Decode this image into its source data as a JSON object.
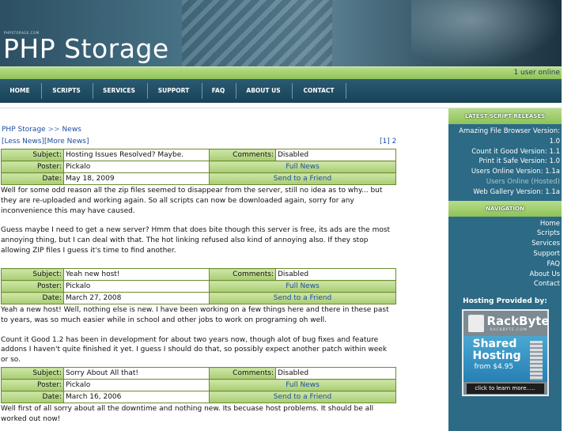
{
  "site": {
    "title": "PHP Storage",
    "header_fineprint": "PHPSTORAGE.COM",
    "users_online": "1 user online"
  },
  "nav": {
    "items": [
      {
        "label": "HOME"
      },
      {
        "label": "SCRIPTS"
      },
      {
        "label": "SERVICES"
      },
      {
        "label": "SUPPORT"
      },
      {
        "label": "FAQ"
      },
      {
        "label": "ABOUT US"
      },
      {
        "label": "CONTACT"
      }
    ]
  },
  "breadcrumb": {
    "root": "PHP Storage",
    "separator": ">>",
    "current": "News"
  },
  "pager": {
    "less": "[Less News]",
    "more": "[More News]",
    "page_current": "[1]",
    "page_next": "2"
  },
  "labels": {
    "subject": "Subject:",
    "poster": "Poster:",
    "date": "Date:",
    "comments": "Comments:",
    "full_news": "Full News",
    "send": "Send to a Friend"
  },
  "news": [
    {
      "subject": "Hosting Issues Resolved? Maybe.",
      "poster": "Pickalo",
      "date": "May 18, 2009",
      "comments": "Disabled",
      "body": [
        "Well for some odd reason all the zip files seemed to disappear from the server, still no idea as to why... but they are re-uploaded and working again. So all scripts can now be downloaded again, sorry for any inconvenience this may have caused.",
        "Guess maybe I need to get a new server? Hmm that does bite though this server is free, its ads are the most annoying thing, but I can deal with that. The hot linking refused also kind of annoying also. If they stop allowing ZIP files I guess it's time to find another."
      ]
    },
    {
      "subject": "Yeah new host!",
      "poster": "Pickalo",
      "date": "March 27, 2008",
      "comments": "Disabled",
      "body": [
        "Yeah a new host! Well, nothing else is new. I have been working on a few things here and there in these past to years, was so much easier while in school and other jobs to work on programing oh well.",
        "Count it Good 1.2 has been in development for about two years now, though alot of bug fixes and feature addons I haven't quite finished it yet. I guess I should do that, so possibly expect another patch within week or so."
      ]
    },
    {
      "subject": "Sorry About All that!",
      "poster": "Pickalo",
      "date": "March 16, 2006",
      "comments": "Disabled",
      "body": [
        "Well first of all sorry about all the downtime and nothing new. Its becuase host problems. It should be all worked out now!"
      ]
    }
  ],
  "sidebar": {
    "releases_title": "LATEST SCRIPT RELEASES",
    "releases": [
      "Amazing File Browser Version:",
      "1.0",
      "Count it Good Version: 1.1",
      "Print it Safe Version: 1.0",
      "Users Online Version: 1.1a",
      "Users Online (Hosted)",
      "Web Gallery Version: 1.1a"
    ],
    "nav_title": "NAVIGATION",
    "nav_links": [
      "Home",
      "Scripts",
      "Services",
      "Support",
      "FAQ",
      "About Us",
      "Contact"
    ],
    "hosting_label": "Hosting Provided by:",
    "ad": {
      "brand": "RackByte",
      "brand_sub": "RACKBYTE.COM",
      "shared": "Shared",
      "hosting": "Hosting",
      "price": "from $4.95",
      "cta": "click to learn more....."
    }
  },
  "colors": {
    "nav_bg": "#184257",
    "accent_green": "#a8cd74",
    "link_blue": "#1f4ea0",
    "sidebar_bg": "#2c6a85"
  }
}
